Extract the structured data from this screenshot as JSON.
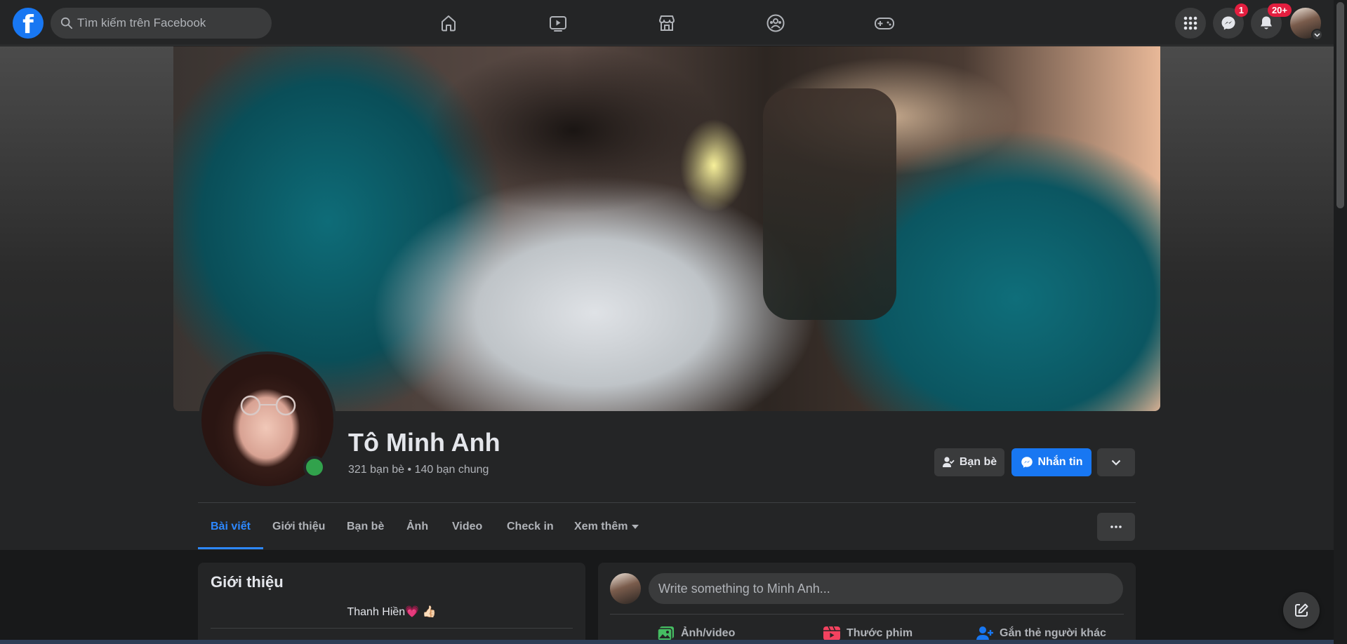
{
  "topbar": {
    "search_placeholder": "Tìm kiếm trên Facebook",
    "nav_icons": [
      "home-icon",
      "watch-icon",
      "marketplace-icon",
      "groups-icon",
      "gaming-icon"
    ],
    "messenger_badge": "1",
    "notifications_badge": "20+"
  },
  "profile": {
    "name": "Tô Minh Anh",
    "friends_info": "321 bạn bè • 140 bạn chung",
    "friend_button": "Bạn bè",
    "message_button": "Nhắn tin"
  },
  "tabs": [
    {
      "label": "Bài viết",
      "active": true
    },
    {
      "label": "Giới thiệu"
    },
    {
      "label": "Bạn bè"
    },
    {
      "label": "Ảnh"
    },
    {
      "label": "Video"
    },
    {
      "label": "Check in"
    },
    {
      "label": "Xem thêm"
    }
  ],
  "intro": {
    "title": "Giới thiệu",
    "bio": "Thanh Hiền💗 👍🏻"
  },
  "composer": {
    "placeholder": "Write something to Minh Anh...",
    "actions": [
      {
        "label": "Ảnh/video",
        "icon": "photo-video-icon",
        "color": "#45bd62"
      },
      {
        "label": "Thước phim",
        "icon": "reels-icon",
        "color": "#f3425f"
      },
      {
        "label": "Gắn thẻ người khác",
        "icon": "tag-people-icon",
        "color": "#1877f2"
      }
    ]
  },
  "colors": {
    "accent": "#1877f2",
    "online": "#31a24c",
    "badge": "#e41e3f"
  }
}
